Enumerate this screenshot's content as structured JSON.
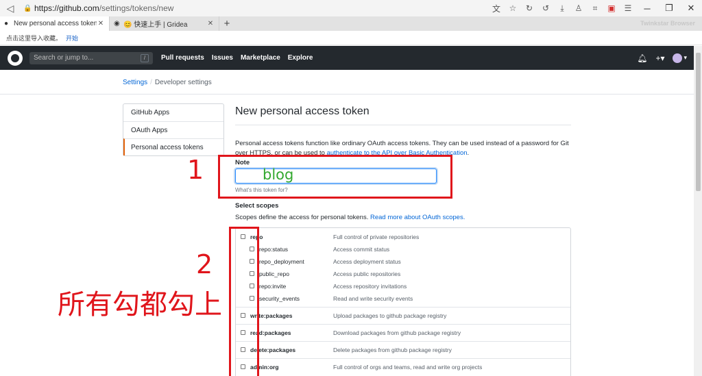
{
  "browser": {
    "url_domain": "https://github.com",
    "url_path": "/settings/tokens/new",
    "tabs": [
      {
        "title": "New personal access token",
        "active": true
      },
      {
        "title": "😊 快速上手 | Gridea",
        "active": false
      }
    ],
    "brand": "Twinkstar Browser",
    "bookmark_prompt": "点击这里导入收藏。",
    "bookmark_link": "开始"
  },
  "header": {
    "search_placeholder": "Search or jump to...",
    "search_key": "/",
    "nav": [
      "Pull requests",
      "Issues",
      "Marketplace",
      "Explore"
    ],
    "plus": "+▾",
    "avatar_caret": "▾"
  },
  "breadcrumb": {
    "settings": "Settings",
    "separator": "/",
    "current": "Developer settings"
  },
  "sidebar": {
    "items": [
      {
        "label": "GitHub Apps"
      },
      {
        "label": "OAuth Apps"
      },
      {
        "label": "Personal access tokens"
      }
    ]
  },
  "main": {
    "title": "New personal access token",
    "intro_text": "Personal access tokens function like ordinary OAuth access tokens. They can be used instead of a password for Git over HTTPS, or can be used to ",
    "intro_link": "authenticate to the API over Basic Authentication",
    "intro_end": ".",
    "note_label": "Note",
    "note_value": "",
    "note_hint": "What's this token for?",
    "scopes_label": "Select scopes",
    "scopes_desc": "Scopes define the access for personal tokens. ",
    "scopes_link": "Read more about OAuth scopes."
  },
  "scopes": [
    {
      "name": "repo",
      "desc": "Full control of private repositories",
      "level": 0
    },
    {
      "name": "repo:status",
      "desc": "Access commit status",
      "level": 1
    },
    {
      "name": "repo_deployment",
      "desc": "Access deployment status",
      "level": 1
    },
    {
      "name": "public_repo",
      "desc": "Access public repositories",
      "level": 1
    },
    {
      "name": "repo:invite",
      "desc": "Access repository invitations",
      "level": 1
    },
    {
      "name": "security_events",
      "desc": "Read and write security events",
      "level": 1
    },
    {
      "name": "write:packages",
      "desc": "Upload packages to github package registry",
      "level": 0
    },
    {
      "name": "read:packages",
      "desc": "Download packages from github package registry",
      "level": 0
    },
    {
      "name": "delete:packages",
      "desc": "Delete packages from github package registry",
      "level": 0
    },
    {
      "name": "admin:org",
      "desc": "Full control of orgs and teams, read and write org projects",
      "level": 0
    }
  ],
  "annotations": {
    "label_1": "1",
    "label_2": "2",
    "instruction": "所有勾都勾上",
    "typed_text": "blog",
    "color": "#e0151b",
    "typed_color": "#33a82f"
  },
  "colors": {
    "header_bg": "#24292e",
    "link": "#0366d6",
    "selected_accent": "#e36209"
  }
}
